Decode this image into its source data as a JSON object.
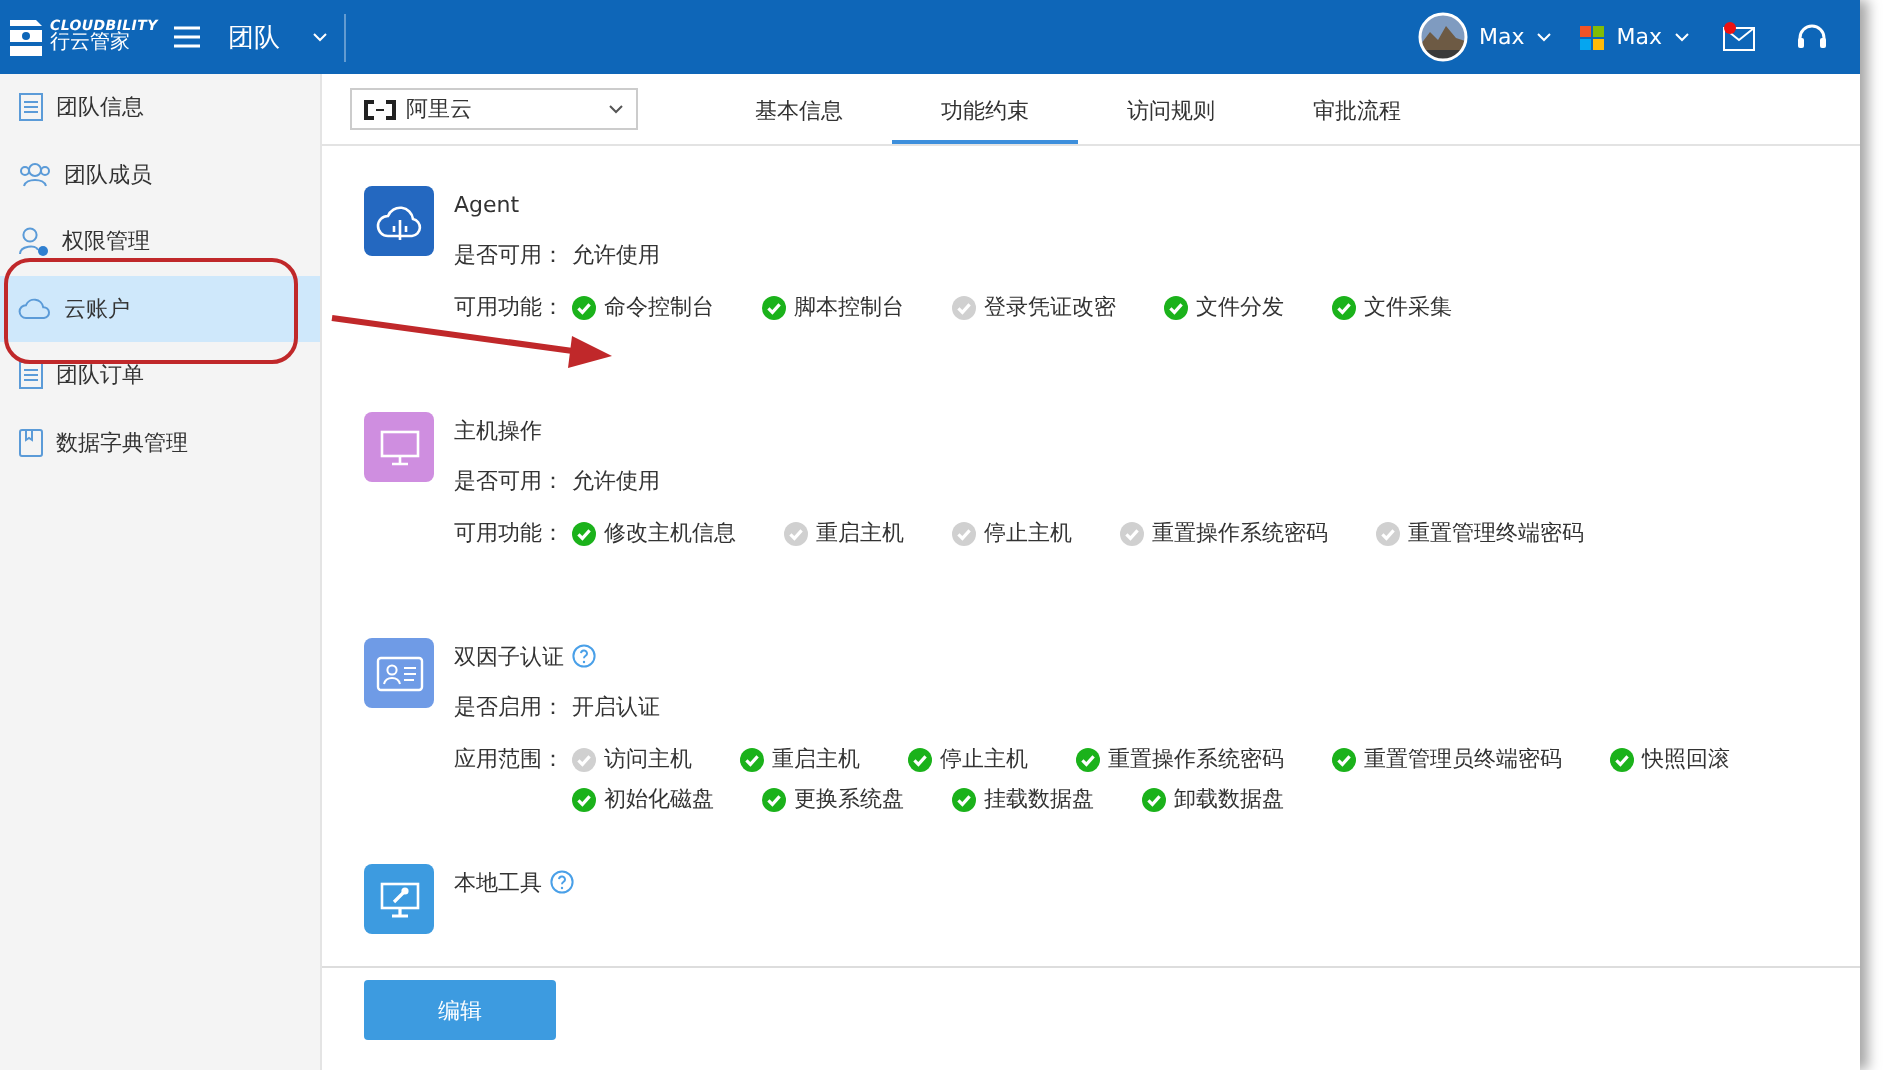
{
  "header": {
    "logo": {
      "name": "CLOUDBILITY",
      "subtitle": "行云管家"
    },
    "team": "团队",
    "user": "Max",
    "account": "Max",
    "mail_unread": true
  },
  "sidebar": {
    "items": [
      {
        "label": "团队信息",
        "selected": false
      },
      {
        "label": "团队成员",
        "selected": false
      },
      {
        "label": "权限管理",
        "selected": false
      },
      {
        "label": "云账户",
        "selected": true
      },
      {
        "label": "团队订单",
        "selected": false
      },
      {
        "label": "数据字典管理",
        "selected": false
      }
    ]
  },
  "provider_select": {
    "value": "阿里云"
  },
  "tabs": [
    {
      "label": "基本信息",
      "selected": false
    },
    {
      "label": "功能约束",
      "selected": true
    },
    {
      "label": "访问规则",
      "selected": false
    },
    {
      "label": "审批流程",
      "selected": false
    }
  ],
  "sections": [
    {
      "title": "Agent",
      "color": "#2468c0",
      "help": false,
      "status_label": "是否可用：",
      "status": "允许使用",
      "features_label": "可用功能：",
      "features": [
        {
          "label": "命令控制台",
          "enabled": true
        },
        {
          "label": "脚本控制台",
          "enabled": true
        },
        {
          "label": "登录凭证改密",
          "enabled": false
        },
        {
          "label": "文件分发",
          "enabled": true
        },
        {
          "label": "文件采集",
          "enabled": true
        }
      ]
    },
    {
      "title": "主机操作",
      "color": "#cf8ee0",
      "help": false,
      "status_label": "是否可用：",
      "status": "允许使用",
      "features_label": "可用功能：",
      "features": [
        {
          "label": "修改主机信息",
          "enabled": true
        },
        {
          "label": "重启主机",
          "enabled": false
        },
        {
          "label": "停止主机",
          "enabled": false
        },
        {
          "label": "重置操作系统密码",
          "enabled": false
        },
        {
          "label": "重置管理终端密码",
          "enabled": false
        }
      ]
    },
    {
      "title": "双因子认证",
      "color": "#6f9be6",
      "help": true,
      "status_label": "是否启用：",
      "status": "开启认证",
      "features_label": "应用范围：",
      "features": [
        {
          "label": "访问主机",
          "enabled": false
        },
        {
          "label": "重启主机",
          "enabled": true
        },
        {
          "label": "停止主机",
          "enabled": true
        },
        {
          "label": "重置操作系统密码",
          "enabled": true
        },
        {
          "label": "重置管理员终端密码",
          "enabled": true
        },
        {
          "label": "快照回滚",
          "enabled": true
        },
        {
          "label": "初始化磁盘",
          "enabled": true
        },
        {
          "label": "更换系统盘",
          "enabled": true
        },
        {
          "label": "挂载数据盘",
          "enabled": true
        },
        {
          "label": "卸载数据盘",
          "enabled": true
        }
      ]
    },
    {
      "title": "本地工具",
      "color": "#3d9be0",
      "help": true
    }
  ],
  "edit_button": "编辑"
}
